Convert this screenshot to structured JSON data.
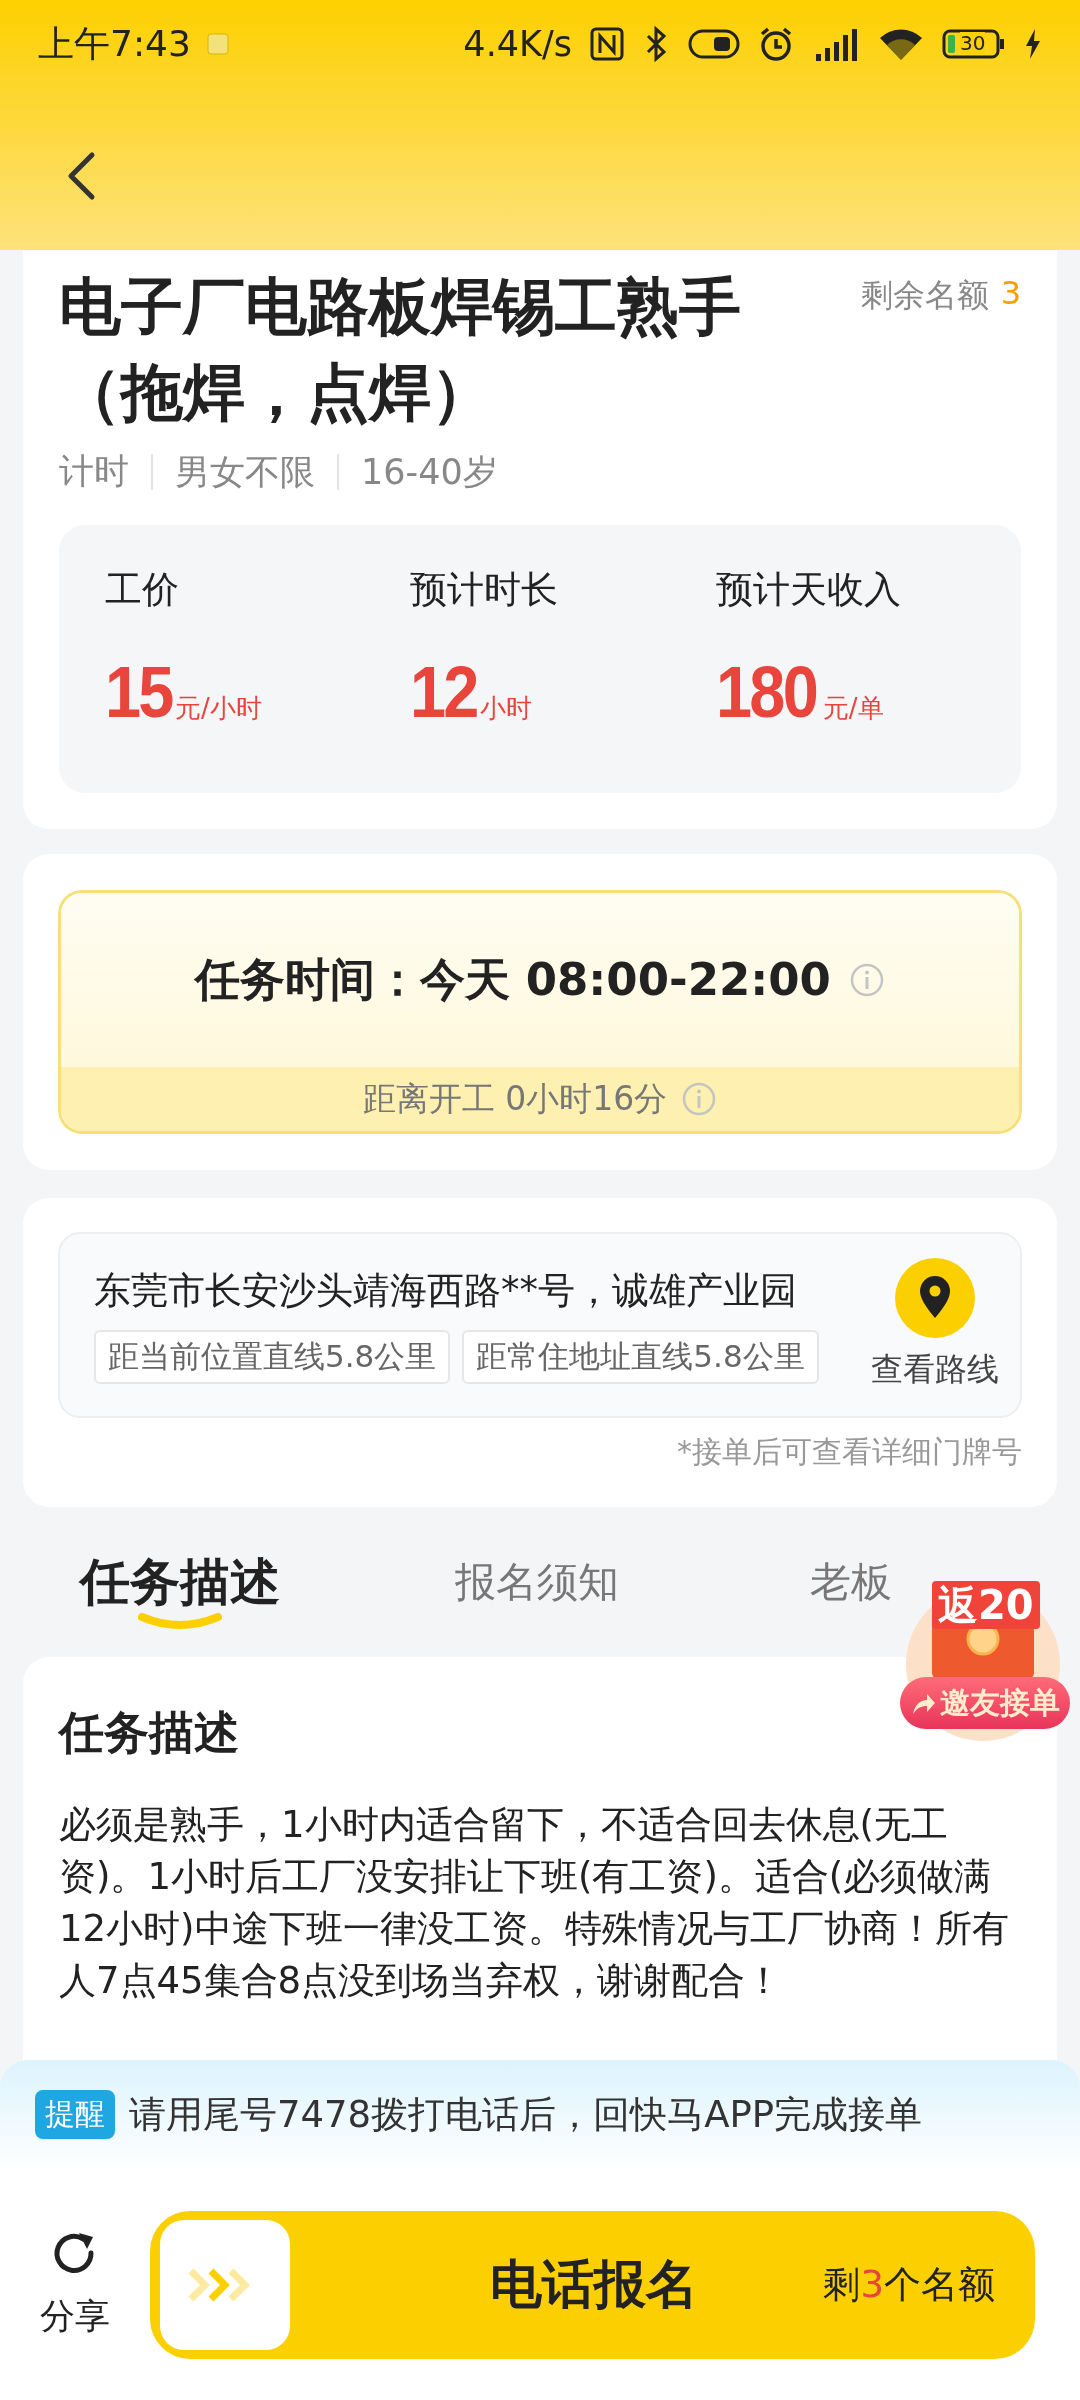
{
  "status_bar": {
    "time": "上午7:43",
    "speed": "4.4K/s",
    "battery": "30"
  },
  "job": {
    "title": "电子厂电路板焊锡工熟手（拖焊，点焊）",
    "quota_label": "剩余名额",
    "quota": "3",
    "tags": [
      "计时",
      "男女不限",
      "16-40岁"
    ],
    "stats": [
      {
        "label": "工价",
        "value": "15",
        "unit": "元/小时"
      },
      {
        "label": "预计时长",
        "value": "12",
        "unit": "小时"
      },
      {
        "label": "预计天收入",
        "value": "180",
        "unit": "元/单"
      }
    ]
  },
  "schedule": {
    "time": "任务时间：今天 08:00-22:00",
    "countdown": "距离开工 0小时16分"
  },
  "location": {
    "address": "东莞市长安沙头靖海西路**号，诚雄产业园",
    "distances": [
      "距当前位置直线5.8公里",
      "距常住地址直线5.8公里"
    ],
    "route": "查看路线",
    "note": "*接单后可查看详细门牌号"
  },
  "tabs": [
    {
      "label": "任务描述",
      "selected": true
    },
    {
      "label": "报名须知",
      "selected": false
    },
    {
      "label": "老板",
      "selected": false
    }
  ],
  "promo": {
    "badge": "返20",
    "action": "邀友接单"
  },
  "description": {
    "heading": "任务描述",
    "body": "必须是熟手，1小时内适合留下，不适合回去休息(无工资)。1小时后工厂没安排让下班(有工资)。适合(必须做满12小时)中途下班一律没工资。特殊情况与工厂协商！所有人7点45集合8点没到场当弃权，谢谢配合！"
  },
  "reminder": {
    "tag": "提醒",
    "text": "请用尾号7478拨打电话后，回快马APP完成接单"
  },
  "bottom": {
    "share": "分享",
    "button": "电话报名",
    "remaining_prefix": "剩",
    "remaining": "3",
    "remaining_suffix": "个名额"
  }
}
